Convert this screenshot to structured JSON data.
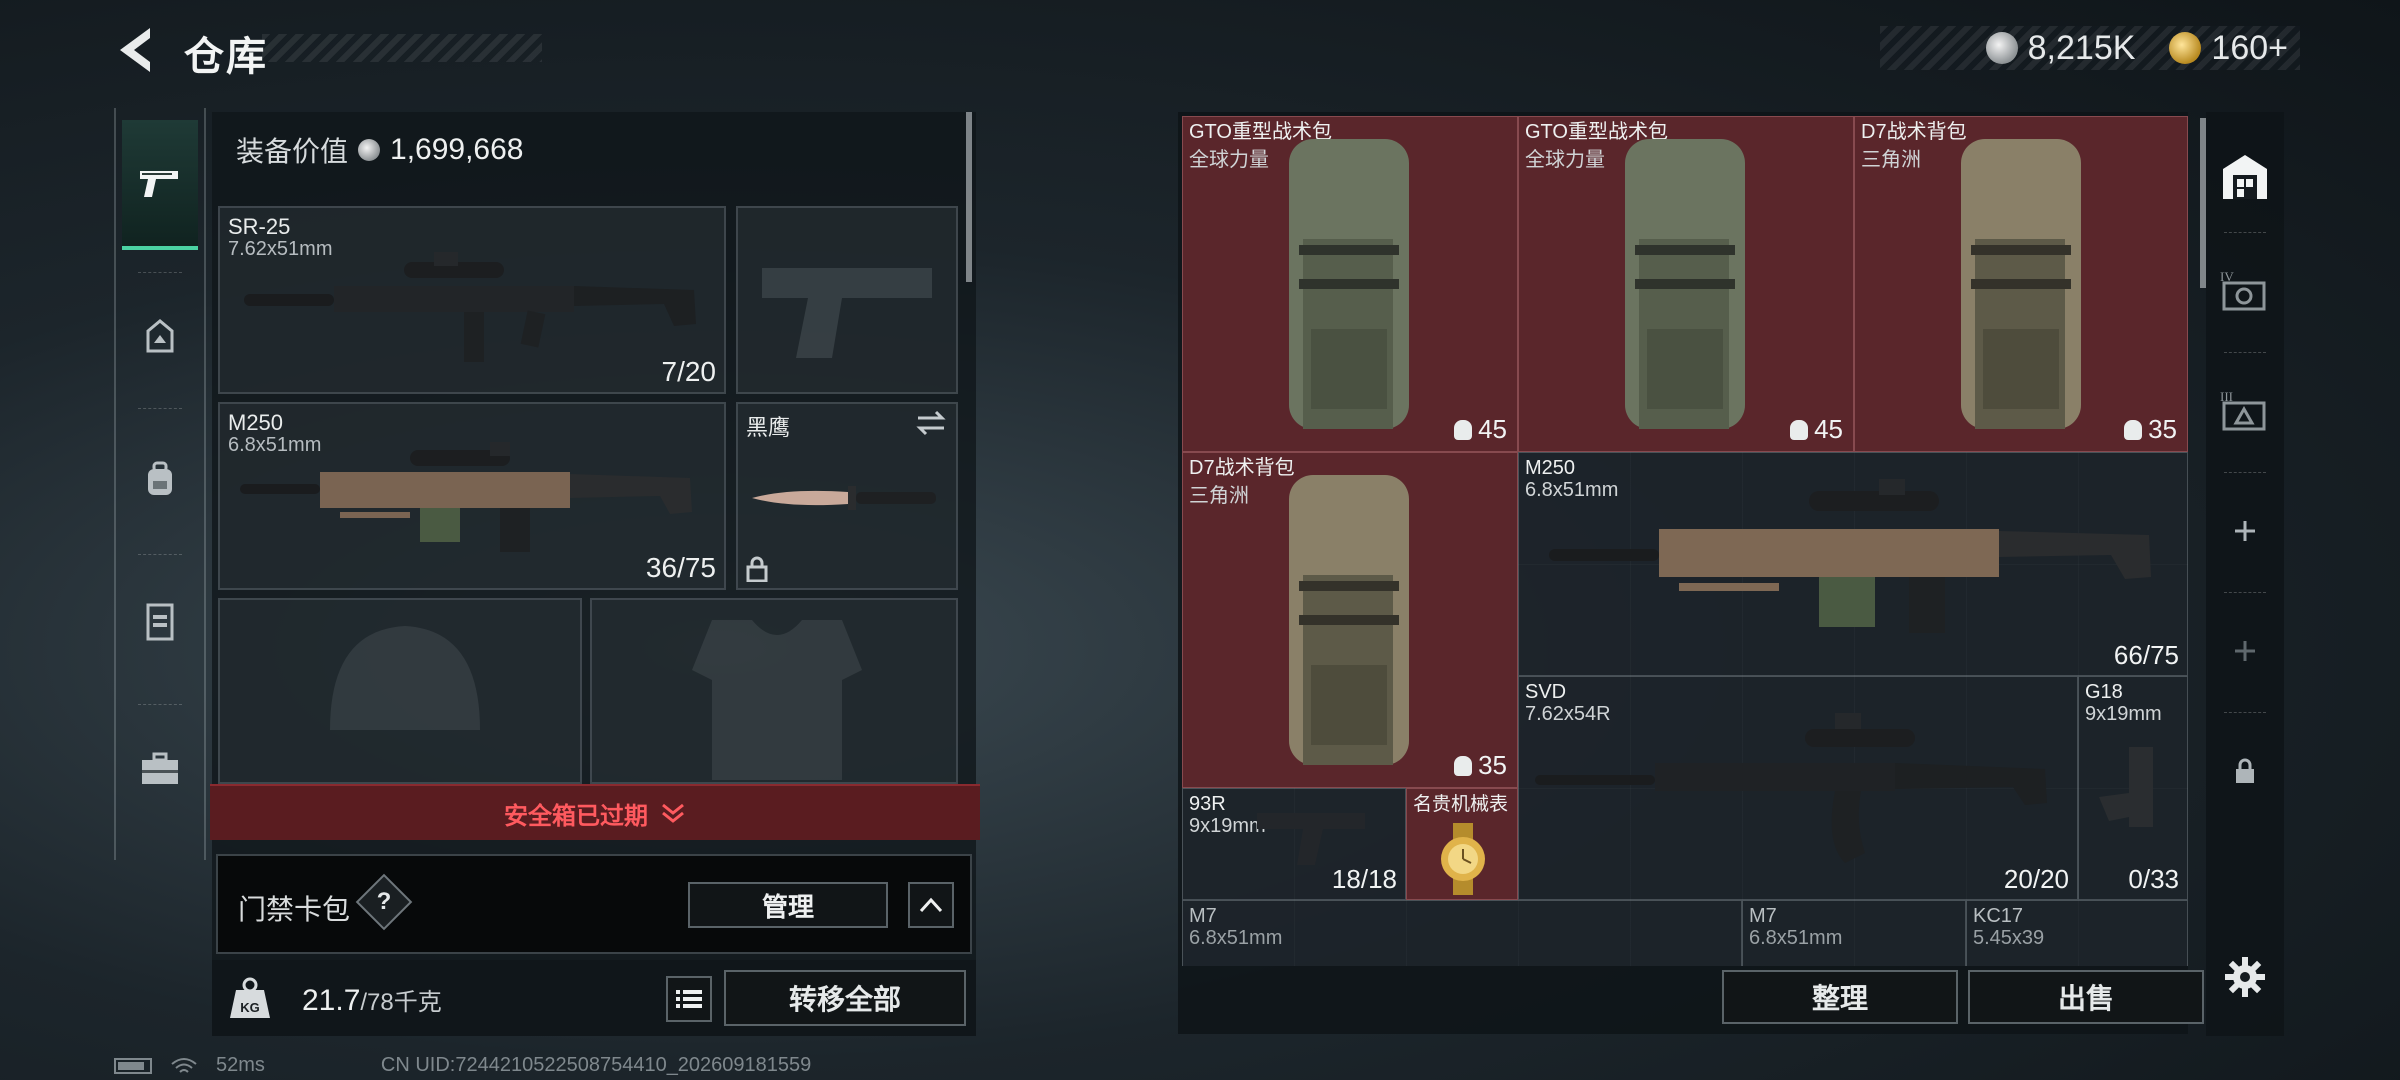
{
  "header": {
    "title": "仓库",
    "currency_silver": "8,215K",
    "currency_gold": "160+"
  },
  "sidebar": {
    "items": [
      {
        "name": "weapons",
        "icon": "pistol-icon",
        "active": true
      },
      {
        "name": "helmet",
        "icon": "helmet-icon",
        "active": false
      },
      {
        "name": "backpack",
        "icon": "backpack-icon",
        "active": false
      },
      {
        "name": "vest",
        "icon": "vest-icon",
        "active": false
      },
      {
        "name": "case",
        "icon": "briefcase-icon",
        "active": false
      }
    ]
  },
  "equipment": {
    "value_label": "装备价值",
    "value": "1,699,668",
    "primary": {
      "name": "SR-25",
      "caliber": "7.62x51mm",
      "ammo": "7/20"
    },
    "secondary": {
      "name": "M250",
      "caliber": "6.8x51mm",
      "ammo": "36/75"
    },
    "melee": {
      "name": "黑鹰"
    },
    "safebox_text": "安全箱已过期",
    "access_card_label": "门禁卡包",
    "access_help": "?",
    "manage_label": "管理",
    "weight_current": "21.7",
    "weight_max": "/78千克",
    "transfer_label": "转移全部"
  },
  "storage": {
    "items": [
      {
        "name": "GTO重型战术包",
        "sub": "全球力量",
        "cap": "45"
      },
      {
        "name": "GTO重型战术包",
        "sub": "全球力量",
        "cap": "45"
      },
      {
        "name": "D7战术背包",
        "sub": "三角洲",
        "cap": "35"
      },
      {
        "name": "D7战术背包",
        "sub": "三角洲",
        "cap": "35"
      },
      {
        "name": "M250",
        "sub": "6.8x51mm",
        "count": "66/75"
      },
      {
        "name": "SVD",
        "sub": "7.62x54R",
        "count": "20/20"
      },
      {
        "name": "G18",
        "sub": "9x19mm",
        "count": "0/33"
      },
      {
        "name": "93R",
        "sub": "9x19mm",
        "count": "18/18"
      },
      {
        "name": "名贵机械表",
        "sub": ""
      },
      {
        "name": "M7",
        "sub": "6.8x51mm"
      },
      {
        "name": "M7",
        "sub": "6.8x51mm"
      },
      {
        "name": "KC17",
        "sub": "5.45x39"
      }
    ],
    "sort_label": "整理",
    "sell_label": "出售"
  },
  "footer": {
    "ping": "52ms",
    "uid": "CN UID:7244210522508754410_202609181559"
  },
  "colors": {
    "accent_green": "#4bd3a3",
    "alert_red": "#ff5a5f",
    "rare_cell": "#5a262b"
  }
}
